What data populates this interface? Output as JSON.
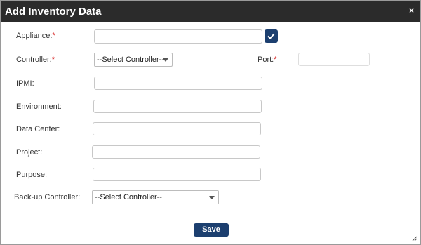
{
  "dialog": {
    "title": "Add Inventory Data",
    "close_icon": "×"
  },
  "fields": {
    "appliance": {
      "label": "Appliance:",
      "required": "*",
      "value": ""
    },
    "controller": {
      "label": "Controller:",
      "required": "*",
      "selected": "--Select Controller--"
    },
    "port": {
      "label": "Port:",
      "required": "*",
      "value": ""
    },
    "ipmi": {
      "label": "IPMI:",
      "value": ""
    },
    "environment": {
      "label": "Environment:",
      "value": ""
    },
    "data_center": {
      "label": "Data Center:",
      "value": ""
    },
    "project": {
      "label": "Project:",
      "value": ""
    },
    "purpose": {
      "label": "Purpose:",
      "value": ""
    },
    "backup_controller": {
      "label": "Back-up Controller:",
      "selected": "--Select Controller--"
    }
  },
  "buttons": {
    "save_label": "Save"
  },
  "colors": {
    "titlebar": "#2b2b2b",
    "primary": "#1c3f6f",
    "required": "#d00000"
  },
  "icons": {
    "confirm": "check-icon",
    "close": "close-icon",
    "resize": "resize-grip-icon"
  }
}
